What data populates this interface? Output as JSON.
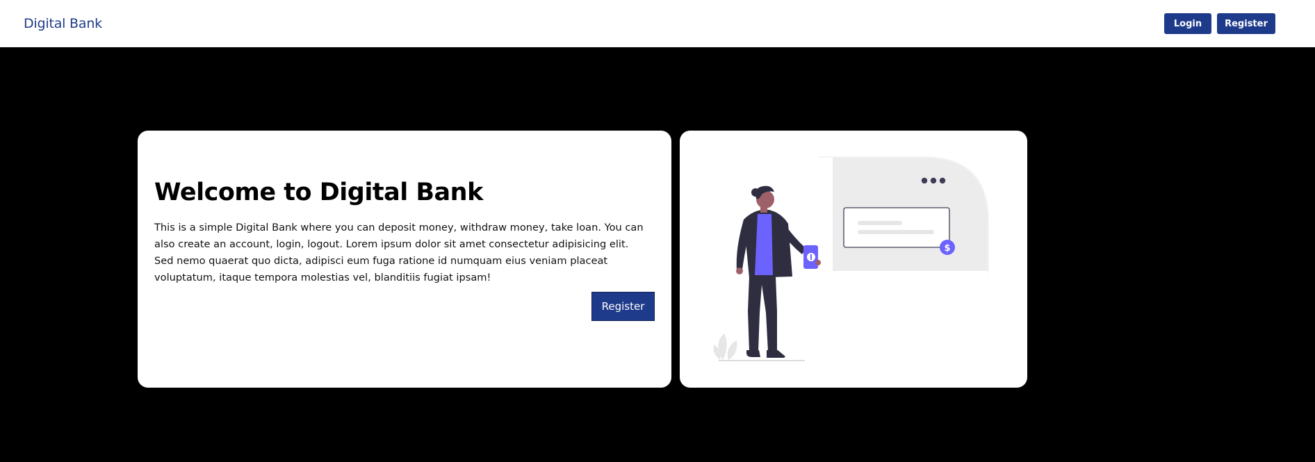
{
  "navbar": {
    "brand": "Digital Bank",
    "login_label": "Login",
    "register_label": "Register"
  },
  "hero": {
    "title": "Welcome to Digital Bank",
    "description": "This is a simple Digital Bank where you can deposit money, withdraw money, take loan. You can also create an account, login, logout. Lorem ipsum dolor sit amet consectetur adipisicing elit. Sed nemo quaerat quo dicta, adipisci eum fuga ratione id numquam eius veniam placeat voluptatum, itaque tempora molestias vel, blanditiis fugiat ipsam!",
    "register_label": "Register"
  },
  "illustration": {
    "icon": "person-holding-phone-payment-illustration",
    "coin_symbol": "$",
    "colors": {
      "accent": "#6c63ff",
      "dark": "#2f2e41",
      "primary": "#1e3a8a"
    }
  }
}
